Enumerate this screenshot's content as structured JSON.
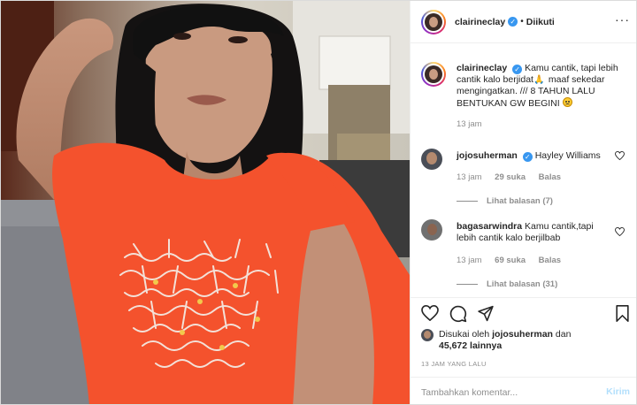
{
  "post": {
    "username": "clairineclay",
    "follow_state": "Diikuti",
    "caption_user": "clairineclay",
    "caption_text_1": "Kamu cantik, tapi lebih cantik kalo berjidat",
    "caption_text_2": "maaf sekedar mengingatkan. /// 8 TAHUN LALU BENTUKAN GW BEGINI",
    "caption_time": "13 jam"
  },
  "comments": [
    {
      "user": "jojosuherman",
      "text": "Hayley Williams",
      "time": "13 jam",
      "likes": "29 suka",
      "reply": "Balas",
      "view_replies": "Lihat balasan (7)"
    },
    {
      "user": "bagasarwindra",
      "text": "Kamu cantik,tapi lebih cantik kalo berjilbab",
      "time": "13 jam",
      "likes": "69 suka",
      "reply": "Balas",
      "view_replies": "Lihat balasan (31)"
    }
  ],
  "likes": {
    "prefix": "Disukai oleh",
    "user": "jojosuherman",
    "connector": "dan",
    "count": "45,672",
    "suffix": "lainnya"
  },
  "time_ago": "13 JAM YANG LALU",
  "comment_box": {
    "placeholder": "Tambahkan komentar...",
    "post_label": "Kirim"
  },
  "colors": {
    "accent": "#3897f0",
    "post_disabled": "#b2dffc",
    "shirt": "#f4522d"
  },
  "icons": [
    "verified-badge-icon",
    "more-options-icon",
    "heart-icon",
    "comment-icon",
    "share-icon",
    "bookmark-icon",
    "prayer-emoji-icon",
    "sad-emoji-icon"
  ]
}
